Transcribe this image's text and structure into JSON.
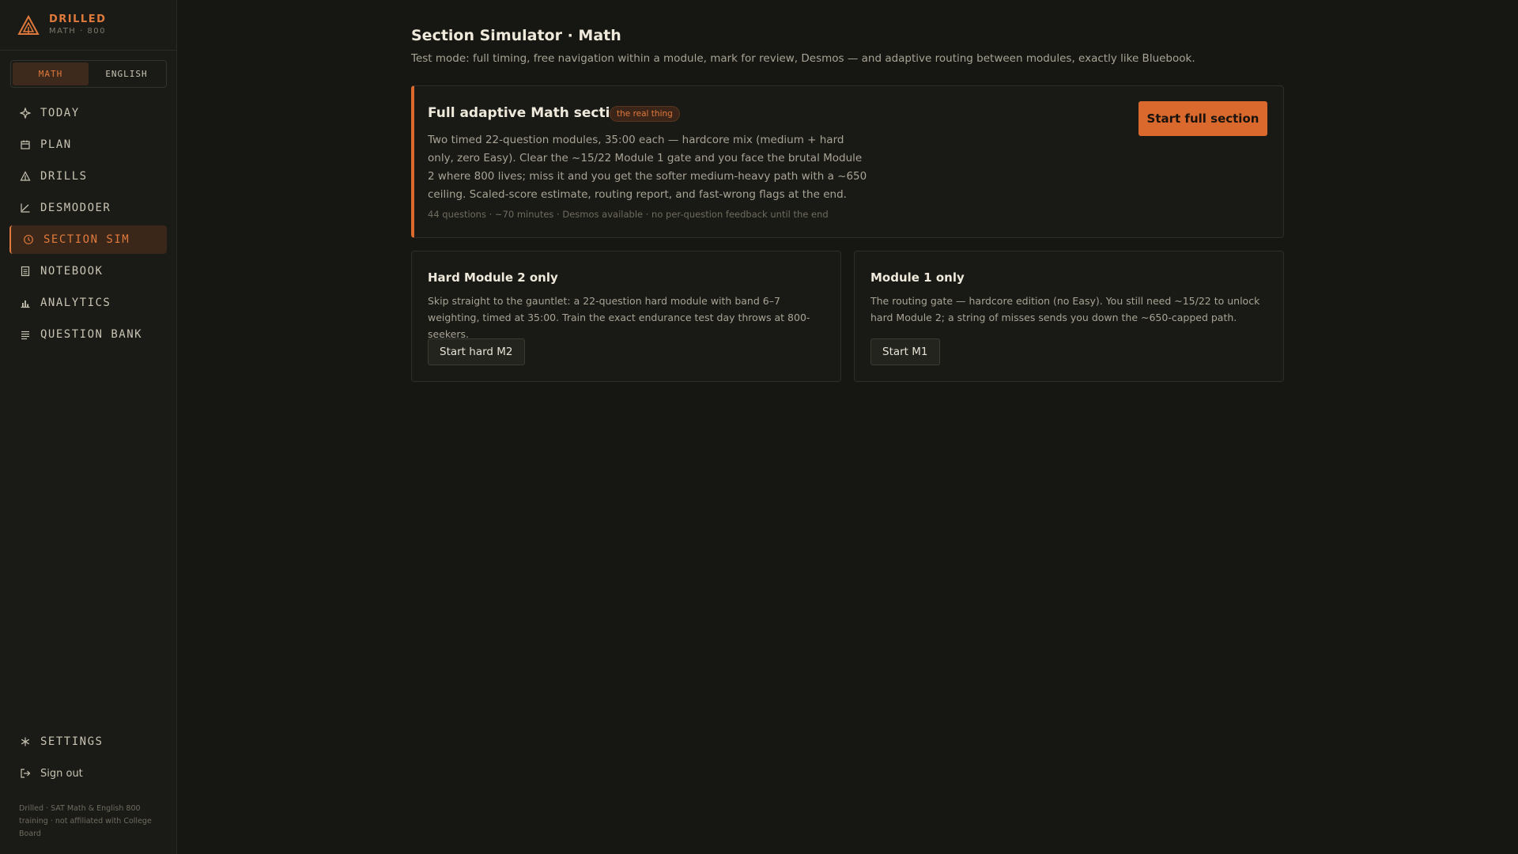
{
  "brand": {
    "name": "DRILLED",
    "sub": "MATH · 800",
    "accent": "#e07a3c"
  },
  "subject_toggle": {
    "math": "MATH",
    "english": "ENGLISH",
    "selected": "MATH"
  },
  "nav": [
    {
      "label": "TODAY",
      "icon": "sparkle-icon"
    },
    {
      "label": "PLAN",
      "icon": "calendar-icon"
    },
    {
      "label": "DRILLS",
      "icon": "triangle-icon"
    },
    {
      "label": "DESMODOER",
      "icon": "graph-axis-icon"
    },
    {
      "label": "SECTION SIM",
      "icon": "clock-icon",
      "active": true
    },
    {
      "label": "NOTEBOOK",
      "icon": "notebook-icon"
    },
    {
      "label": "ANALYTICS",
      "icon": "bar-chart-icon"
    },
    {
      "label": "QUESTION BANK",
      "icon": "list-icon"
    }
  ],
  "nav_bottom": {
    "settings": "SETTINGS",
    "signout": "Sign out"
  },
  "footer": "Drilled · SAT Math & English 800 training · not affiliated with College Board",
  "page": {
    "title": "Section Simulator · Math",
    "subtitle": "Test mode: full timing, free navigation within a module, mark for review, Desmos — and adaptive routing between modules, exactly like Bluebook."
  },
  "feature": {
    "title": "Full adaptive Math section",
    "badge": "the real thing",
    "description": "Two timed 22-question modules, 35:00 each — hardcore mix (medium + hard only, zero Easy). Clear the ~15/22 Module 1 gate and you face the brutal Module 2 where 800 lives; miss it and you get the softer medium-heavy path with a ~650 ceiling. Scaled-score estimate, routing report, and fast-wrong flags at the end.",
    "meta": "44 questions · ~70 minutes · Desmos available · no per-question feedback until the end",
    "button": "Start full section"
  },
  "modules": {
    "hard_m2": {
      "title": "Hard Module 2 only",
      "description": "Skip straight to the gauntlet: a 22-question hard module with band 6–7 weighting, timed at 35:00. Train the exact endurance test day throws at 800-seekers.",
      "button": "Start hard M2"
    },
    "m1": {
      "title": "Module 1 only",
      "description": "The routing gate — hardcore edition (no Easy). You still need ~15/22 to unlock hard Module 2; a string of misses sends you down the ~650-capped path.",
      "button": "Start M1"
    }
  }
}
